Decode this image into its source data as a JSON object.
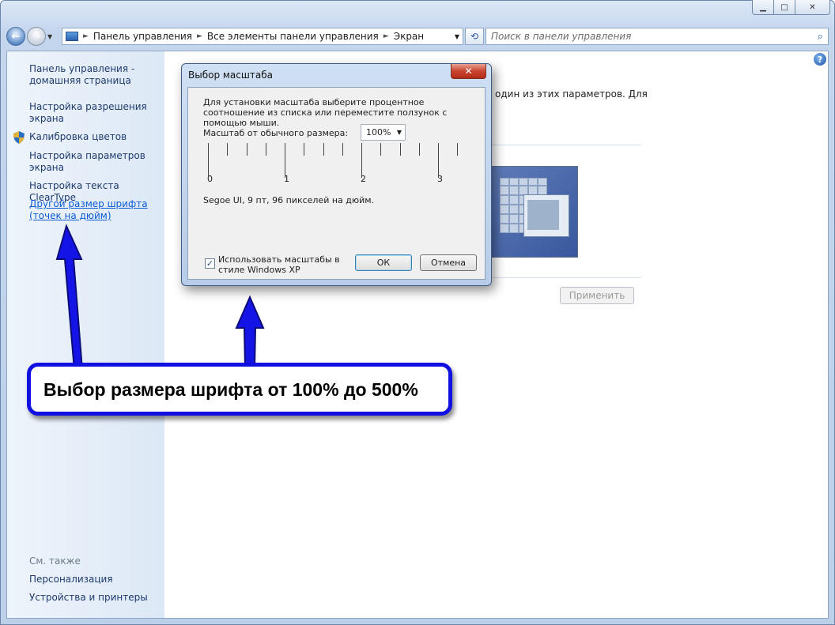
{
  "window": {
    "minimize_glyph": "▁",
    "maximize_glyph": "□",
    "close_glyph": "✕"
  },
  "navigation": {
    "back_glyph": "←",
    "forward_glyph": "→",
    "dropdown_glyph": "▼",
    "address": {
      "segments": [
        "Панель управления",
        "Все элементы панели управления",
        "Экран"
      ],
      "separator": "►",
      "dropdown_glyph": "▼"
    },
    "refresh_glyph": "⟲",
    "search": {
      "placeholder": "Поиск в панели управления",
      "icon": "search-icon",
      "glyph": "⌕"
    }
  },
  "sidebar": {
    "items": [
      {
        "label_line1": "Панель управления -",
        "label_line2": "домашняя страница"
      },
      {
        "label_line1": "Настройка разрешения",
        "label_line2": "экрана"
      },
      {
        "label_line1": "Калибровка цветов",
        "label_line2": ""
      },
      {
        "label_line1": "Настройка параметров",
        "label_line2": "экрана"
      },
      {
        "label_line1": "Настройка текста ClearType",
        "label_line2": ""
      },
      {
        "label_line1": "Другой размер шрифта",
        "label_line2": "(точек на дюйм)"
      }
    ],
    "see_also": {
      "heading": "См. также",
      "items": [
        "Персонализация",
        "Устройства и принтеры"
      ]
    }
  },
  "main": {
    "help_glyph": "?",
    "partial_text": "один из этих параметров. Для",
    "apply_label": "Применить"
  },
  "dialog": {
    "title": "Выбор масштаба",
    "close_glyph": "✕",
    "description": "Для установки масштаба выберите процентное соотношение из списка или переместите ползунок с помощью мыши.",
    "scale_label": "Масштаб от обычного размера:",
    "scale_value": "100%",
    "combo_arrow": "▼",
    "ruler_numbers": [
      "0",
      "1",
      "2",
      "3"
    ],
    "font_info": "Segoe UI, 9 пт, 96 пикселей на дюйм.",
    "checkbox": {
      "checked": true,
      "mark": "✓",
      "label": "Использовать масштабы в стиле Windows XP"
    },
    "ok_label": "ОК",
    "cancel_label": "Отмена"
  },
  "annotation": {
    "text": "Выбор размера шрифта от 100% до 500%",
    "arrow_color": "#1414e6"
  }
}
